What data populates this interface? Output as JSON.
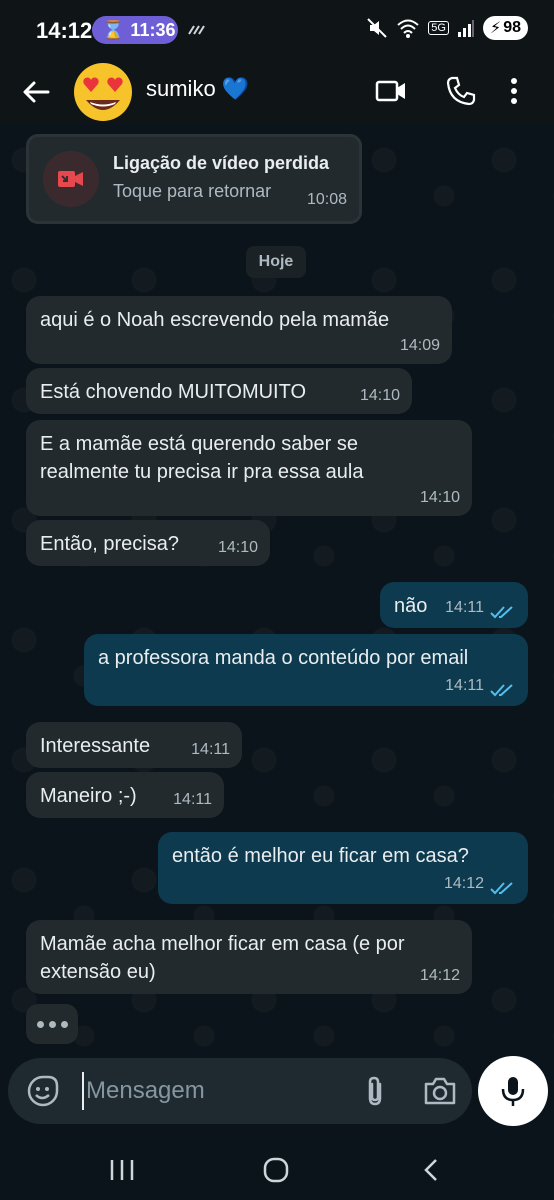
{
  "status_bar": {
    "time": "14:12",
    "timer": "11:36",
    "battery": "98",
    "network_tag": "5G"
  },
  "header": {
    "contact_name": "sumiko",
    "contact_heart": "💙",
    "avatar_emoji": "😍"
  },
  "missed_call": {
    "title": "Ligação de vídeo perdida",
    "subtitle": "Toque para retornar",
    "time": "10:08"
  },
  "date_divider": "Hoje",
  "messages": [
    {
      "dir": "in",
      "text": "aqui é o Noah escrevendo pela mamãe",
      "time": "14:09"
    },
    {
      "dir": "in",
      "text": "Está chovendo MUITOMUITO",
      "time": "14:10"
    },
    {
      "dir": "in",
      "text": "E a mamãe está querendo saber se realmente tu precisa ir pra essa aula",
      "time": "14:10"
    },
    {
      "dir": "in",
      "text": "Então, precisa?",
      "time": "14:10"
    },
    {
      "dir": "out",
      "text": "não",
      "time": "14:11"
    },
    {
      "dir": "out",
      "text": "a professora manda o conteúdo por email",
      "time": "14:11"
    },
    {
      "dir": "in",
      "text": "Interessante",
      "time": "14:11"
    },
    {
      "dir": "in",
      "text": "Maneiro ;-)",
      "time": "14:11"
    },
    {
      "dir": "out",
      "text": "então é melhor eu ficar em casa?",
      "time": "14:12"
    },
    {
      "dir": "in",
      "text": "Mamãe acha melhor ficar em casa (e por extensão eu)",
      "time": "14:12"
    }
  ],
  "composer": {
    "placeholder": "Mensagem"
  },
  "colors": {
    "incoming_bubble": "#222a2e",
    "outgoing_bubble": "#0d3a4e",
    "read_ticks": "#53bdeb",
    "missed_call_red": "#e5484d"
  }
}
